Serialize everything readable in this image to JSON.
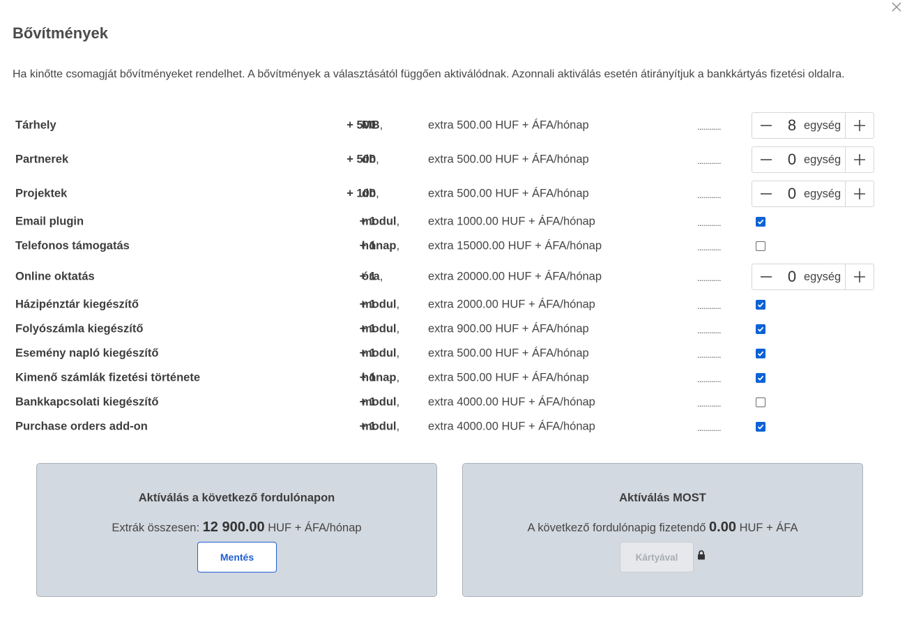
{
  "dialog": {
    "title": "Bővítmények",
    "intro": "Ha kinőtte csomagját bővítményeket rendelhet. A bővítmények a választásától függően aktiválódnak. Azonnali aktiválás esetén átirányítjuk a bankkártyás fizetési oldalra.",
    "close_icon": "close-icon"
  },
  "addons": [
    {
      "name": "Tárhely",
      "qty_prefix": "+",
      "qty": "500",
      "unit": "MB",
      "price": "extra 500.00 HUF + ÁFA/hónap",
      "dots": "............",
      "control": "stepper",
      "value": "8",
      "value_unit": "egység"
    },
    {
      "name": "Partnerek",
      "qty_prefix": "+",
      "qty": "500",
      "unit": "db",
      "price": "extra 500.00 HUF + ÁFA/hónap",
      "dots": "............",
      "control": "stepper",
      "value": "0",
      "value_unit": "egység"
    },
    {
      "name": "Projektek",
      "qty_prefix": "+",
      "qty": "100",
      "unit": "db",
      "price": "extra 500.00 HUF + ÁFA/hónap",
      "dots": "............",
      "control": "stepper",
      "value": "0",
      "value_unit": "egység"
    },
    {
      "name": "Email plugin",
      "qty_prefix": "+",
      "qty": "1",
      "unit": "modul",
      "price": "extra 1000.00 HUF + ÁFA/hónap",
      "dots": "............",
      "control": "checkbox",
      "checked": true
    },
    {
      "name": "Telefonos támogatás",
      "qty_prefix": "+",
      "qty": "1",
      "unit": "hónap",
      "price": "extra 15000.00 HUF + ÁFA/hónap",
      "dots": "............",
      "control": "checkbox",
      "checked": false
    },
    {
      "name": "Online oktatás",
      "qty_prefix": "+",
      "qty": "1",
      "unit": "óra",
      "price": "extra 20000.00 HUF + ÁFA/hónap",
      "dots": "............",
      "control": "stepper",
      "value": "0",
      "value_unit": "egység"
    },
    {
      "name": "Házipénztár kiegészítő",
      "qty_prefix": "+",
      "qty": "1",
      "unit": "modul",
      "price": "extra 2000.00 HUF + ÁFA/hónap",
      "dots": "............",
      "control": "checkbox",
      "checked": true
    },
    {
      "name": "Folyószámla kiegészítő",
      "qty_prefix": "+",
      "qty": "1",
      "unit": "modul",
      "price": "extra 900.00 HUF + ÁFA/hónap",
      "dots": "............",
      "control": "checkbox",
      "checked": true
    },
    {
      "name": "Esemény napló kiegészítő",
      "qty_prefix": "+",
      "qty": "1",
      "unit": "modul",
      "price": "extra 500.00 HUF + ÁFA/hónap",
      "dots": "............",
      "control": "checkbox",
      "checked": true
    },
    {
      "name": "Kimenő számlák fizetési története",
      "qty_prefix": "+",
      "qty": "1",
      "unit": "hónap",
      "price": "extra 500.00 HUF + ÁFA/hónap",
      "dots": "............",
      "control": "checkbox",
      "checked": true
    },
    {
      "name": "Bankkapcsolati kiegészítő",
      "qty_prefix": "+",
      "qty": "1",
      "unit": "modul",
      "price": "extra 4000.00 HUF + ÁFA/hónap",
      "dots": "............",
      "control": "checkbox",
      "checked": false
    },
    {
      "name": "Purchase orders add-on",
      "qty_prefix": "+",
      "qty": "1",
      "unit": "modul",
      "price": "extra 4000.00 HUF + ÁFA/hónap",
      "dots": "............",
      "control": "checkbox",
      "checked": true
    }
  ],
  "panel_next": {
    "title": "Aktíválás a következő fordulónapon",
    "label": "Extrák összesen:",
    "amount": "12 900.00",
    "suffix": "HUF + ÁFA/hónap",
    "button": "Mentés"
  },
  "panel_now": {
    "title": "Aktíválás MOST",
    "label": "A következő fordulónapig fizetendő",
    "amount": "0.00",
    "suffix": "HUF + ÁFA",
    "button": "Kártyával",
    "lock_icon": "lock-icon"
  },
  "colors": {
    "accent": "#1f5ed1",
    "checkbox": "#0b62d6",
    "panel_bg": "#d3d9e0"
  }
}
